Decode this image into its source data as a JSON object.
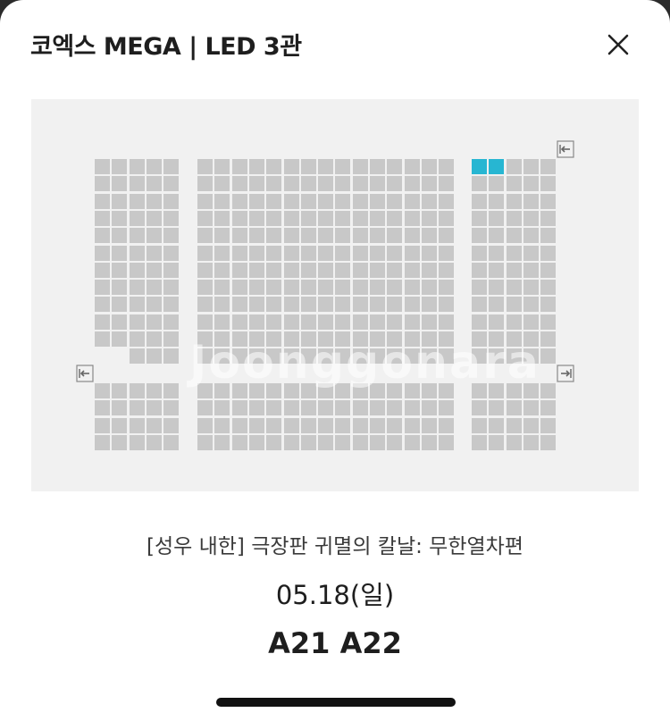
{
  "header": {
    "title": "코엑스 MEGA | LED 3관"
  },
  "close_icon": "close-icon",
  "seat_map": {
    "colors": {
      "seat": "#c8c8c8",
      "selected": "#27b6d2",
      "background": "#f1f1f1"
    },
    "selected_seats": [
      "A21",
      "A22"
    ],
    "exit_icons": [
      "exit-left-icon",
      "exit-right-icon"
    ],
    "watermark": "Joonggonara"
  },
  "booking": {
    "movie_title": "[성우 내한] 극장판 귀멸의 칼날: 무한열차편",
    "date": "05.18(일)",
    "seats": "A21 A22"
  }
}
